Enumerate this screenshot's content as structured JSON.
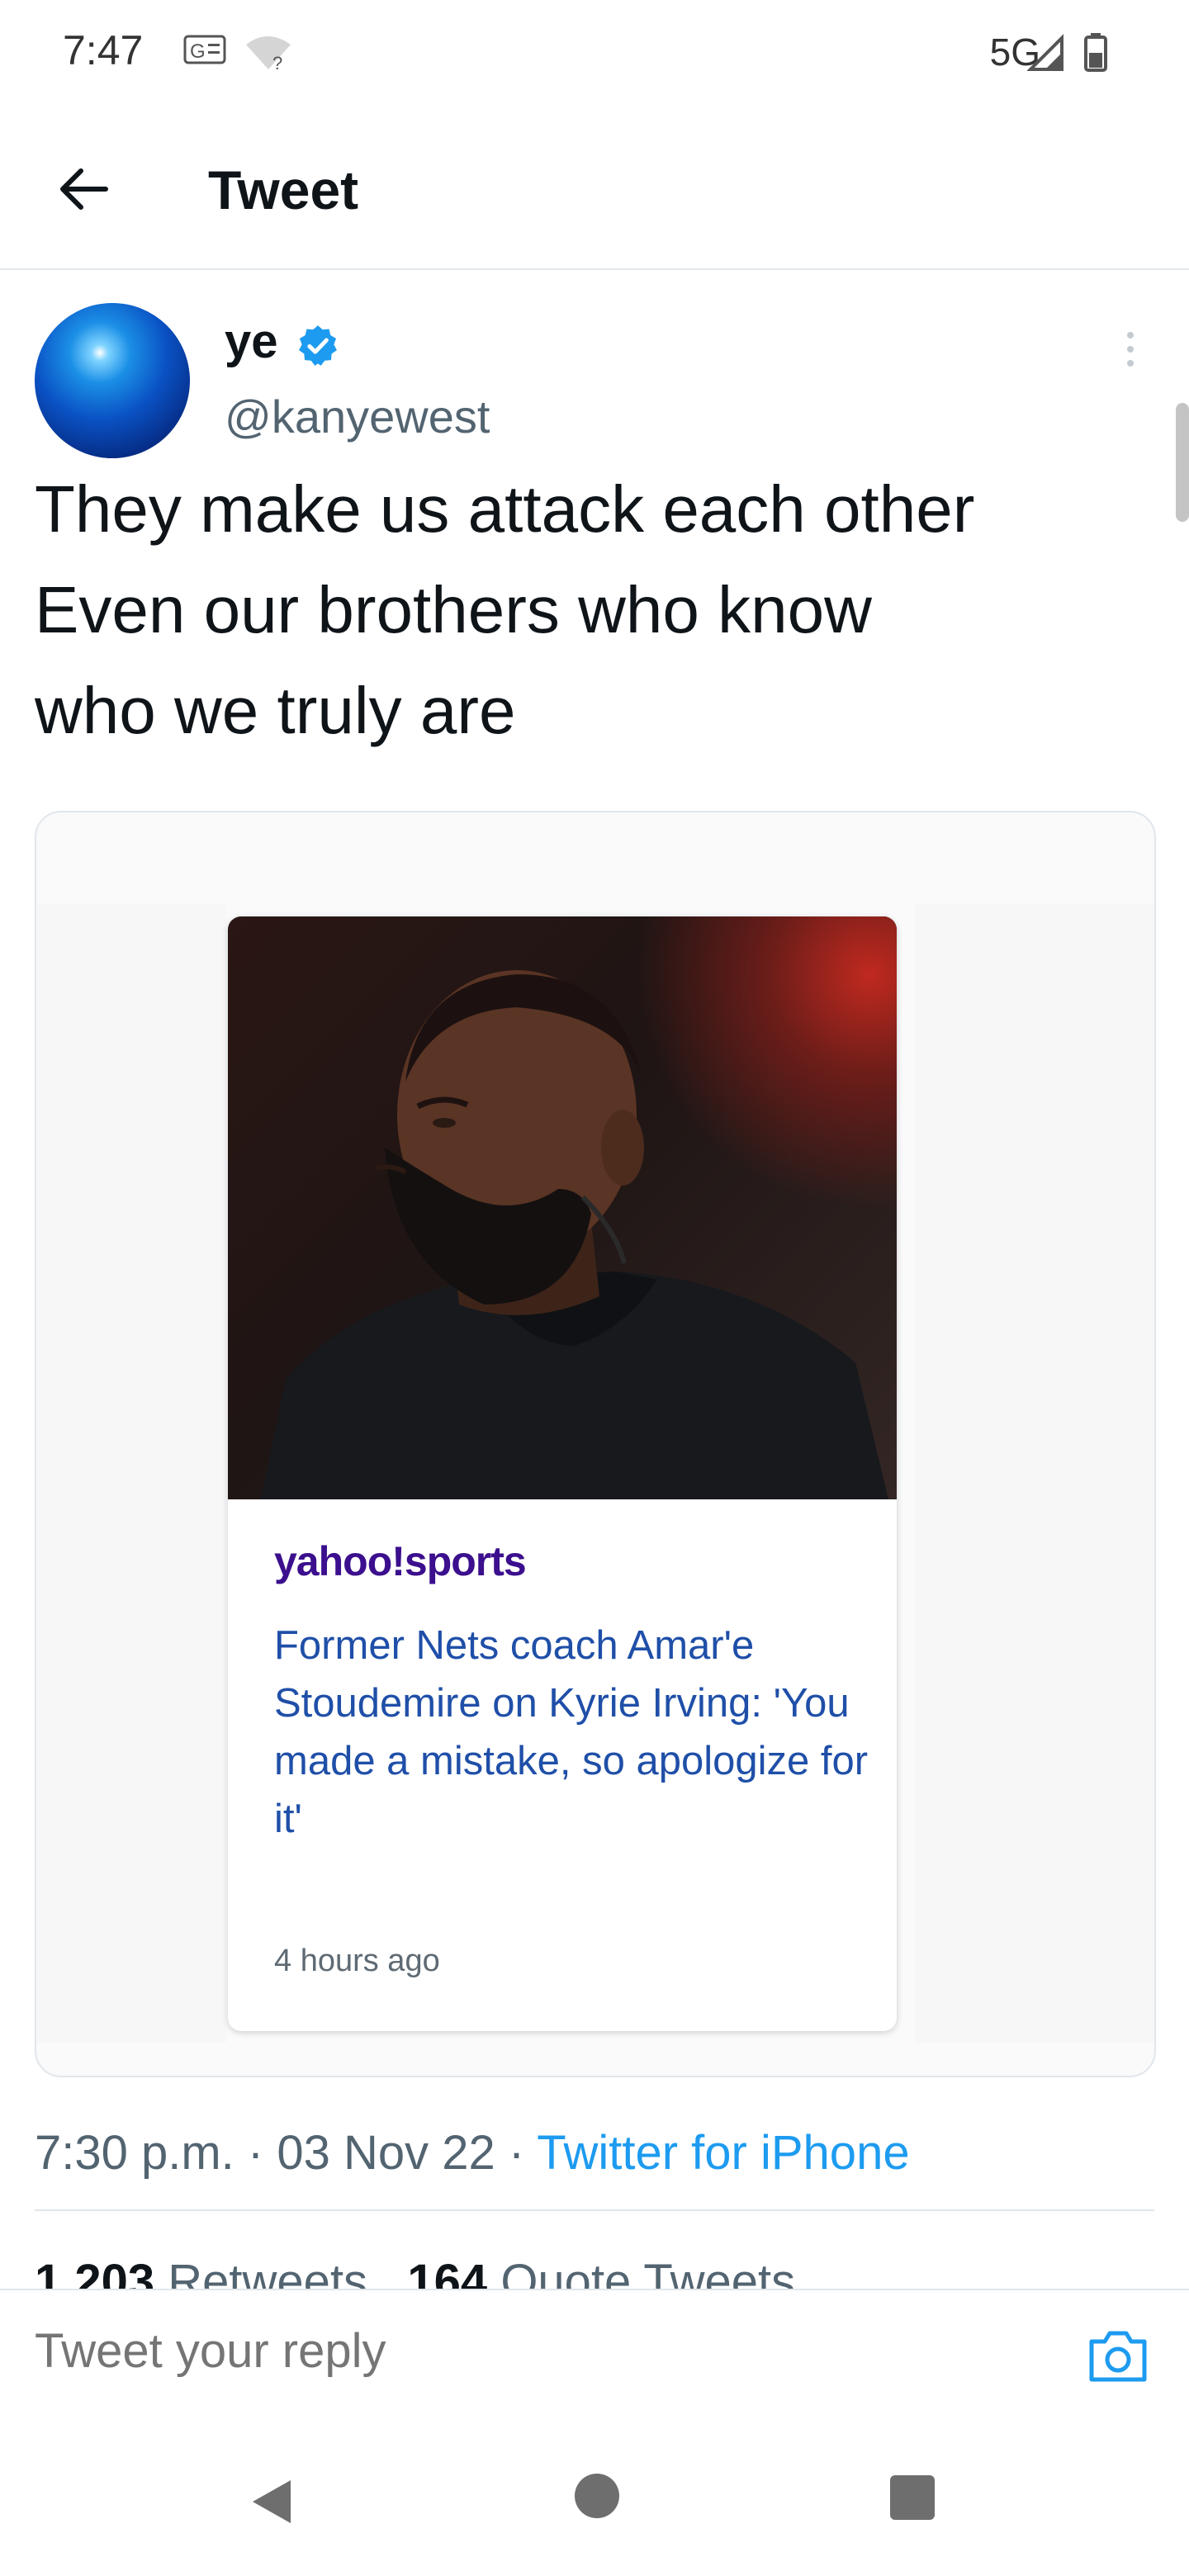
{
  "status_bar": {
    "time": "7:47",
    "network": "5G",
    "icons": [
      "sim-g-icon",
      "wifi-question-icon",
      "signal-icon",
      "battery-icon"
    ]
  },
  "header": {
    "back_icon": "arrow-left-icon",
    "title": "Tweet"
  },
  "tweet": {
    "author_name": "ye",
    "verified": true,
    "handle": "@kanyewest",
    "text_lines": [
      "They make us attack each other",
      "Even our brothers who know",
      "who we truly are"
    ],
    "card": {
      "source": "yahoo!sports",
      "headline": "Former Nets coach Amar'e Stoudemire on Kyrie Irving: 'You made a mistake, so apologize for it'",
      "time": "4 hours ago"
    },
    "timestamp": "7:30 p.m.",
    "separator": " · ",
    "date": "03 Nov 22",
    "client": "Twitter for iPhone",
    "stats": {
      "retweets_count": "1,203",
      "retweets_label": "Retweets",
      "quotes_count": "164",
      "quotes_label": "Quote Tweets"
    }
  },
  "reply": {
    "placeholder": "Tweet your reply",
    "camera_icon": "camera-icon"
  },
  "nav": {
    "icons": [
      "back-triangle-icon",
      "home-circle-icon",
      "recents-square-icon"
    ]
  },
  "colors": {
    "accent": "#1d9bf0",
    "text": "#0f1419",
    "secondary": "#536471",
    "yahoo": "#3b0f8d",
    "headline": "#1f4fa8"
  }
}
